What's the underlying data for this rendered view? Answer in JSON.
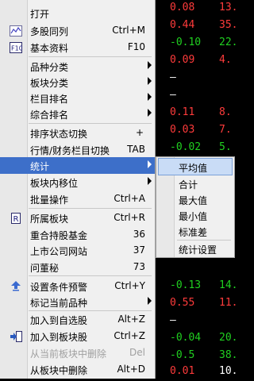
{
  "background_grid": [
    {
      "v1": "0.08",
      "v2": "13.",
      "c1": "red",
      "c2": "red"
    },
    {
      "v1": "0.44",
      "v2": "35.",
      "c1": "red",
      "c2": "red"
    },
    {
      "v1": "-0.10",
      "v2": "22.",
      "c1": "green",
      "c2": "green"
    },
    {
      "v1": "0.09",
      "v2": "4.",
      "c1": "red",
      "c2": "red"
    },
    {
      "v1": "—",
      "v2": "",
      "c1": "white",
      "c2": "white"
    },
    {
      "v1": "—",
      "v2": "",
      "c1": "white",
      "c2": "white"
    },
    {
      "v1": "0.11",
      "v2": "8.",
      "c1": "red",
      "c2": "red"
    },
    {
      "v1": "0.03",
      "v2": "7.",
      "c1": "red",
      "c2": "red"
    },
    {
      "v1": "-0.02",
      "v2": "5.",
      "c1": "green",
      "c2": "green"
    },
    {
      "v1": "-0.13",
      "v2": "14.",
      "c1": "green",
      "c2": "green"
    },
    {
      "v1": "0.55",
      "v2": "11.",
      "c1": "red",
      "c2": "red"
    },
    {
      "v1": "—",
      "v2": "",
      "c1": "white",
      "c2": "white"
    },
    {
      "v1": "-0.04",
      "v2": "20.",
      "c1": "green",
      "c2": "green"
    },
    {
      "v1": "-0.5",
      "v2": "38.",
      "c1": "green",
      "c2": "green"
    },
    {
      "v1": "0.01",
      "v2": "10.",
      "c1": "red",
      "c2": "white"
    }
  ],
  "menu": {
    "items": [
      {
        "label": "打开",
        "shortcut": "",
        "submenu": false
      },
      {
        "label": "多股同列",
        "shortcut": "Ctrl+M",
        "submenu": false,
        "icon": "multi-chart-icon"
      },
      {
        "label": "基本资料",
        "shortcut": "F10",
        "submenu": false,
        "icon": "f10-icon"
      },
      {
        "label": "品种分类",
        "shortcut": "",
        "submenu": true
      },
      {
        "label": "板块分类",
        "shortcut": "",
        "submenu": true
      },
      {
        "label": "栏目排名",
        "shortcut": "",
        "submenu": true
      },
      {
        "label": "综合排名",
        "shortcut": "",
        "submenu": true
      },
      {
        "label": "排序状态切换",
        "shortcut": "+",
        "submenu": false
      },
      {
        "label": "行情/财务栏目切换",
        "shortcut": "TAB",
        "submenu": false
      },
      {
        "label": "统计",
        "shortcut": "",
        "submenu": true,
        "highlighted": true
      },
      {
        "label": "板块内移位",
        "shortcut": "",
        "submenu": true
      },
      {
        "label": "批量操作",
        "shortcut": "Ctrl+A",
        "submenu": false
      },
      {
        "label": "所属板块",
        "shortcut": "Ctrl+R",
        "submenu": false,
        "icon": "r-icon"
      },
      {
        "label": "重合持股基金",
        "shortcut": "36",
        "submenu": false
      },
      {
        "label": "上市公司网站",
        "shortcut": "37",
        "submenu": false
      },
      {
        "label": "问董秘",
        "shortcut": "73",
        "submenu": false
      },
      {
        "label": "设置条件预警",
        "shortcut": "Ctrl+Y",
        "submenu": false,
        "icon": "alert-icon"
      },
      {
        "label": "标记当前品种",
        "shortcut": "",
        "submenu": true
      },
      {
        "label": "加入到自选股",
        "shortcut": "Alt+Z",
        "submenu": false
      },
      {
        "label": "加入到板块股",
        "shortcut": "Ctrl+Z",
        "submenu": false,
        "icon": "add-to-block-icon"
      },
      {
        "label": "从当前板块中删除",
        "shortcut": "Del",
        "submenu": false,
        "disabled": true
      },
      {
        "label": "从板块中删除",
        "shortcut": "Alt+D",
        "submenu": false
      }
    ]
  },
  "submenu": {
    "items": [
      {
        "label": "平均值",
        "highlighted": true
      },
      {
        "label": "合计"
      },
      {
        "label": "最大值"
      },
      {
        "label": "最小值"
      },
      {
        "label": "标准差"
      },
      {
        "label": "统计设置"
      }
    ]
  },
  "colors": {
    "highlight": "#3d6fc9",
    "sub_highlight": "#c9dcf6",
    "up": "#ff3b3b",
    "down": "#20d020"
  }
}
